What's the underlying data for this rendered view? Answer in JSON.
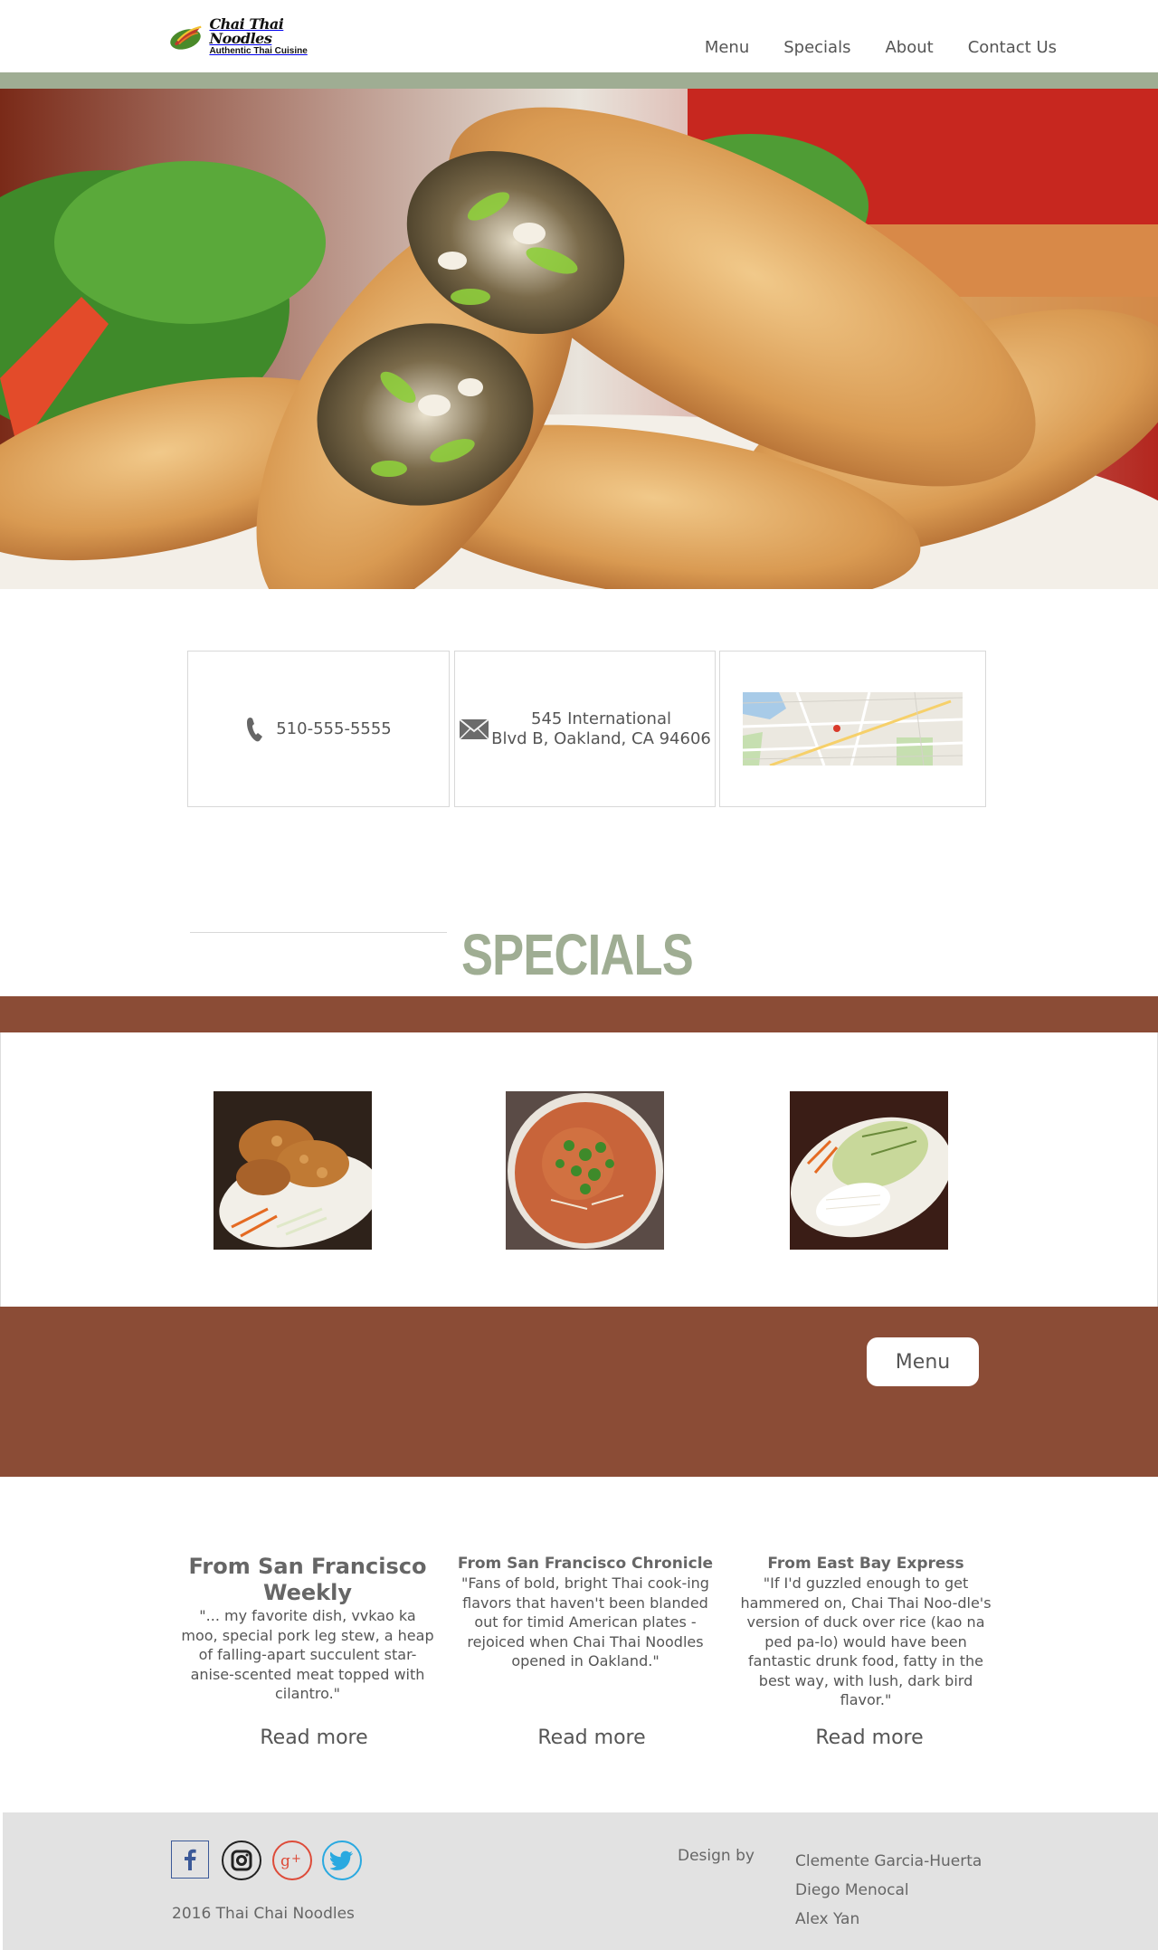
{
  "header": {
    "logo": {
      "name": "Chai Thai Noodles",
      "tagline": "Authentic Thai Cuisine"
    },
    "nav": [
      {
        "label": "Menu"
      },
      {
        "label": "Specials"
      },
      {
        "label": "About"
      },
      {
        "label": "Contact Us"
      }
    ]
  },
  "contact": {
    "phone": "510-555-5555",
    "address_line1": "545 International",
    "address_line2": "Blvd B, Oakland, CA 94606"
  },
  "specials": {
    "title": "SPECIALS",
    "menu_button": "Menu"
  },
  "reviews": [
    {
      "source": "From San Francisco Weekly",
      "quote": "\"... my favorite dish,   vvkao ka moo, special pork leg stew, a heap of falling-apart succulent star-anise-scented meat topped with cilantro.\"",
      "link": "Read more"
    },
    {
      "source": "From San Francisco Chronicle",
      "quote": "\"Fans of bold, bright Thai cook-ing flavors that haven't been blanded out for timid American plates - rejoiced when Chai Thai Noodles opened in Oakland.\"",
      "link": "Read more"
    },
    {
      "source": "From East Bay Express",
      "quote": "\"If I'd guzzled enough to get hammered on, Chai Thai Noo-dle's version of duck over rice (kao na ped pa-lo) would have been fantastic drunk food, fatty in the best way, with lush, dark bird flavor.\"",
      "link": "Read more"
    }
  ],
  "footer": {
    "social": [
      {
        "icon": "facebook-icon",
        "color": "#3b5998"
      },
      {
        "icon": "instagram-icon",
        "color": "#222222"
      },
      {
        "icon": "google-plus-icon",
        "color": "#dd4b39"
      },
      {
        "icon": "twitter-icon",
        "color": "#2aa9e0"
      }
    ],
    "copyright": "2016 Thai Chai Noodles",
    "design_label": "Design by",
    "designers": [
      "Clemente Garcia-Huerta",
      "Diego Menocal",
      "Alex Yan"
    ]
  },
  "colors": {
    "accent_green": "#9fad93",
    "brown": "#8b4c36",
    "footer_bg": "#e2e2e2"
  }
}
